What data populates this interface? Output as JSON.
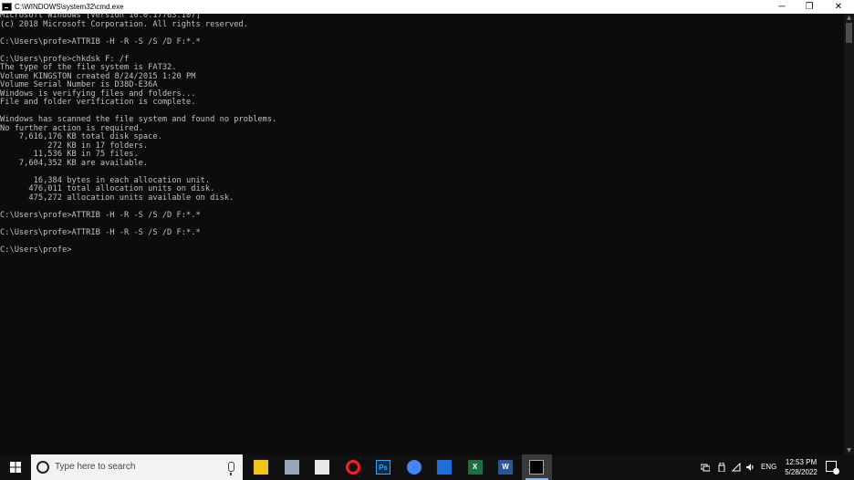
{
  "window": {
    "title": "C:\\WINDOWS\\system32\\cmd.exe",
    "minimize_glyph": "─",
    "restore_glyph": "❐",
    "close_glyph": "✕"
  },
  "console": {
    "lines": [
      "Microsoft Windows [Version 10.0.17763.107]",
      "(c) 2018 Microsoft Corporation. All rights reserved.",
      "",
      "C:\\Users\\profe>ATTRIB -H -R -S /S /D F:*.*",
      "",
      "C:\\Users\\profe>chkdsk F: /f",
      "The type of the file system is FAT32.",
      "Volume KINGSTON created 8/24/2015 1:20 PM",
      "Volume Serial Number is D38D-E36A",
      "Windows is verifying files and folders...",
      "File and folder verification is complete.",
      "",
      "Windows has scanned the file system and found no problems.",
      "No further action is required.",
      "    7,616,176 KB total disk space.",
      "          272 KB in 17 folders.",
      "       11,536 KB in 75 files.",
      "    7,604,352 KB are available.",
      "",
      "       16,384 bytes in each allocation unit.",
      "      476,011 total allocation units on disk.",
      "      475,272 allocation units available on disk.",
      "",
      "C:\\Users\\profe>ATTRIB -H -R -S /S /D F:*.*",
      "",
      "C:\\Users\\profe>ATTRIB -H -R -S /S /D F:*.*",
      "",
      "C:\\Users\\profe>"
    ]
  },
  "taskbar": {
    "search_placeholder": "Type here to search",
    "apps": [
      {
        "name": "file-explorer-icon",
        "label": "",
        "color": "#f0c419",
        "active": false
      },
      {
        "name": "printer-app-icon",
        "label": "",
        "color": "#9aa7b3",
        "active": false
      },
      {
        "name": "paint-app-icon",
        "label": "",
        "color": "#e8e8e8",
        "active": false
      },
      {
        "name": "opera-icon",
        "label": "",
        "color": "#ff1b2d",
        "active": false
      },
      {
        "name": "photoshop-icon",
        "label": "Ps",
        "color": "#0b2c4a",
        "active": false
      },
      {
        "name": "chrome-icon",
        "label": "",
        "color": "#4285f4",
        "active": false
      },
      {
        "name": "window-app-icon",
        "label": "",
        "color": "#1e6fd9",
        "active": false
      },
      {
        "name": "excel-icon",
        "label": "X",
        "color": "#1d6f42",
        "active": false
      },
      {
        "name": "word-icon",
        "label": "W",
        "color": "#2b579a",
        "active": false
      },
      {
        "name": "cmd-icon",
        "label": "",
        "color": "#000000",
        "active": true
      }
    ],
    "language": "ENG",
    "time": "12:53 PM",
    "date": "5/28/2022"
  }
}
